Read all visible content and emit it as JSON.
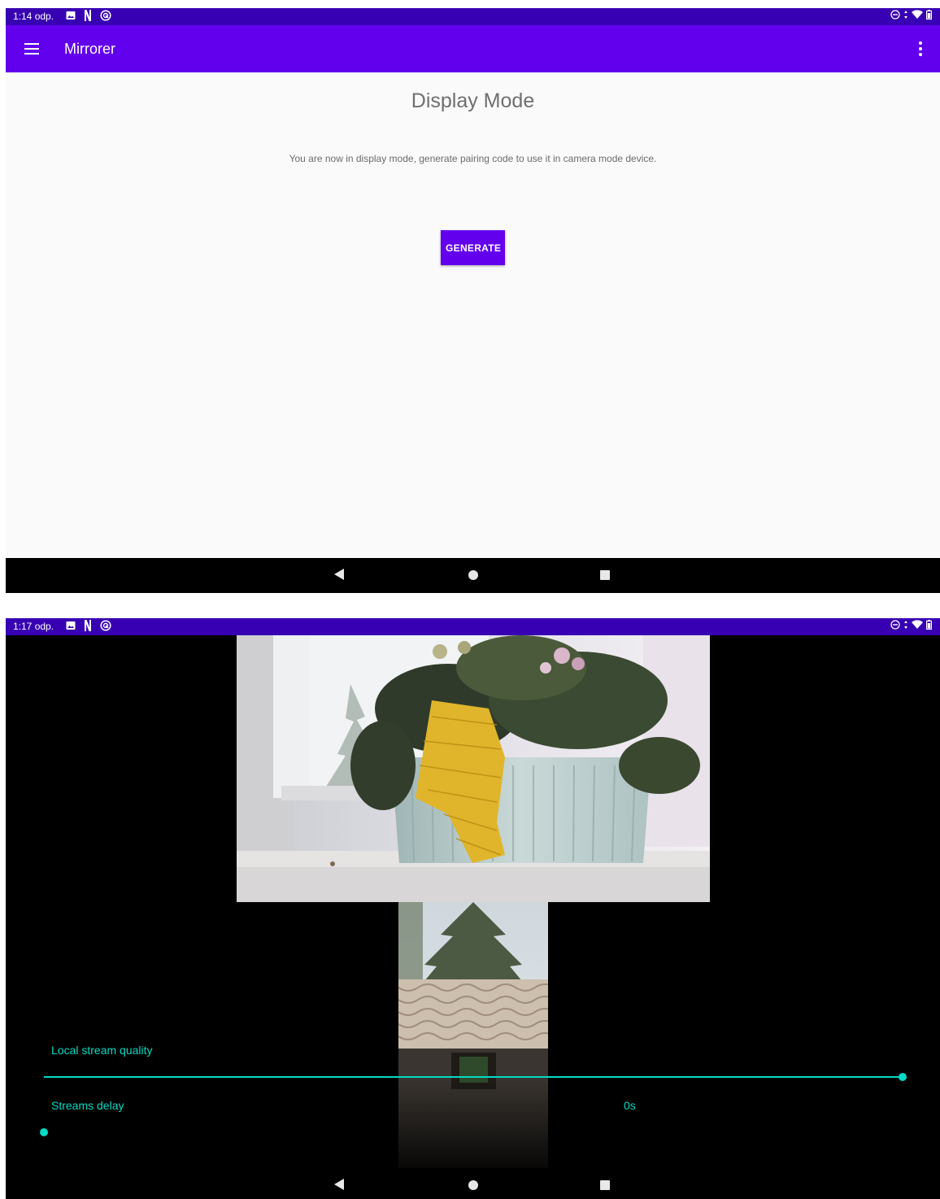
{
  "screen1": {
    "status": {
      "time": "1:14 odp."
    },
    "appbar": {
      "title": "Mirrorer"
    },
    "content": {
      "title": "Display Mode",
      "description": "You are now in display mode, generate pairing code to use it in camera mode device.",
      "generate_label": "GENERATE"
    }
  },
  "screen2": {
    "status": {
      "time": "1:17 odp."
    },
    "controls": {
      "quality_label": "Local stream quality",
      "quality_value": 1.0,
      "delay_label": "Streams delay",
      "delay_value": "0s",
      "delay_slider_value": 0
    }
  },
  "status_icons": [
    "gallery-icon",
    "netflix-icon",
    "cast-icon",
    "dnd-icon",
    "data-arrows-icon",
    "wifi-icon",
    "battery-icon"
  ],
  "colors": {
    "status_bar": "#3700b3",
    "app_bar": "#6200ee",
    "accent": "#03dac5",
    "background": "#fafafa"
  }
}
